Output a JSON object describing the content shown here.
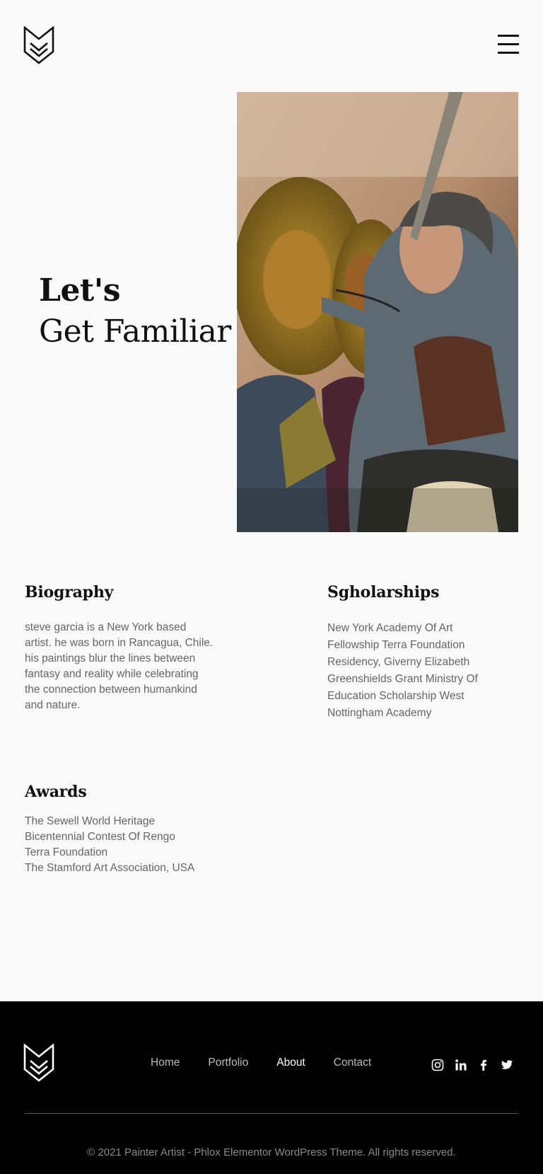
{
  "header": {
    "logo_name": "chevron-logo",
    "menu_icon": "hamburger-menu-icon"
  },
  "hero": {
    "title_line1": "Let's",
    "title_line2": "Get Familiar",
    "image": "photo of painter working on religious icon painting"
  },
  "biography": {
    "heading": "Biography",
    "text": "steve garcia is a New York based artist. he was born in Rancagua, Chile. his paintings blur the lines between fantasy and reality while celebrating the connection between humankind and nature."
  },
  "scholarships": {
    "heading": "Sgholarships",
    "text": "New York Academy Of Art Fellowship Terra Foundation Residency, Giverny Elizabeth Greenshields Grant Ministry Of Education Scholarship West Nottingham Academy"
  },
  "awards": {
    "heading": "Awards",
    "items": [
      "The Sewell World Heritage",
      "Bicentennial Contest Of Rengo",
      "Terra Foundation",
      "The Stamford Art Association, USA"
    ]
  },
  "footer": {
    "nav": [
      {
        "label": "Home"
      },
      {
        "label": "Portfolio"
      },
      {
        "label": "About"
      },
      {
        "label": "Contact"
      }
    ],
    "active_nav": "About",
    "social_icons": [
      "instagram-icon",
      "linkedin-icon",
      "facebook-icon",
      "twitter-icon"
    ],
    "copyright": "© 2021 Painter Artist - Phlox Elementor WordPress Theme. All rights reserved."
  },
  "colors": {
    "background": "#f9f9f9",
    "text_dark": "#111111",
    "text_muted": "#666666",
    "footer_bg": "#000000",
    "footer_link": "#bdbdbd",
    "footer_link_active": "#ffffff"
  }
}
